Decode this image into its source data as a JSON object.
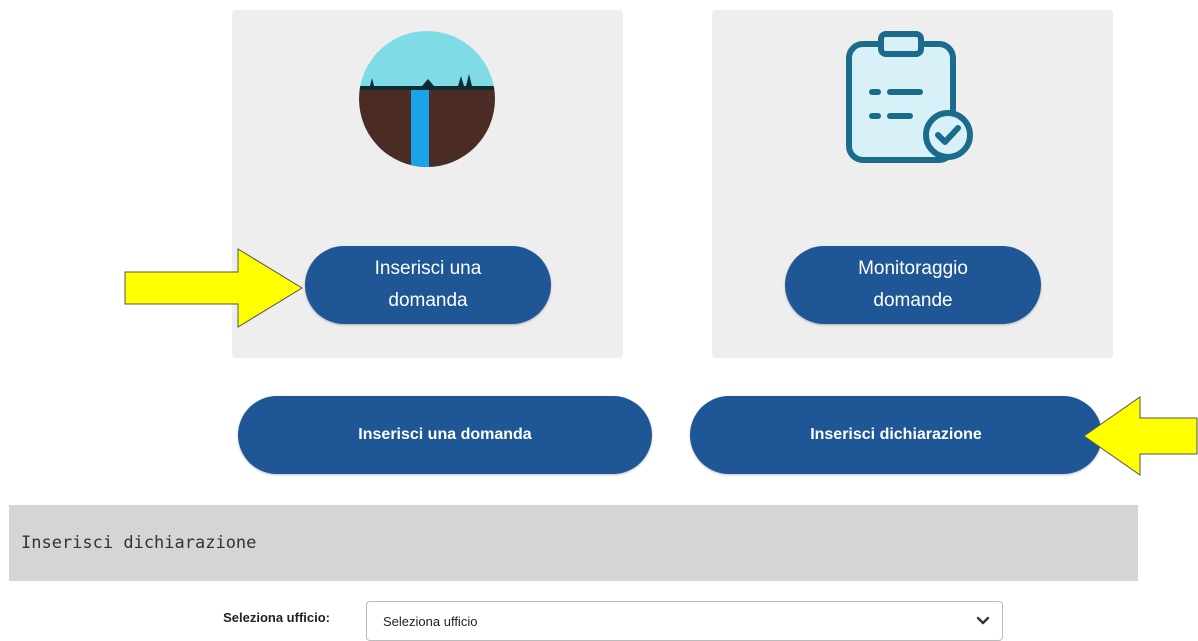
{
  "cards": {
    "left": {
      "button_label_line1": "Inserisci una",
      "button_label_line2": "domanda",
      "icon": "waterfall-icon"
    },
    "right": {
      "button_label_line1": "Monitoraggio",
      "button_label_line2": "domande",
      "icon": "clipboard-check-icon"
    }
  },
  "buttons": {
    "insert_request": "Inserisci una domanda",
    "insert_declaration": "Inserisci dichiarazione"
  },
  "section": {
    "title": "Inserisci dichiarazione"
  },
  "form": {
    "office_label": "Seleziona ufficio:",
    "office_select_value": "Seleziona ufficio"
  },
  "colors": {
    "button_blue": "#1f5796",
    "card_bg": "#eeeeee",
    "arrow_yellow": "#ffff00",
    "icon_teal": "#1a6c8a",
    "icon_light": "#d8f1f8"
  }
}
